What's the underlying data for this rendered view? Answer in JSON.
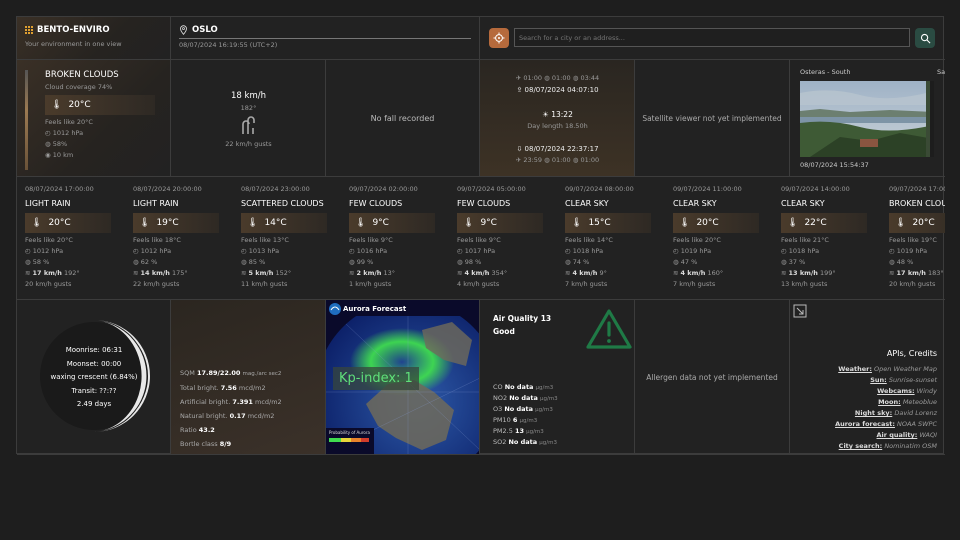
{
  "header": {
    "app_name": "BENTO-ENVIRO",
    "tagline": "Your environment in one view",
    "city": "OSLO",
    "datetime": "08/07/2024 16:19:55 (UTC+2)",
    "search_placeholder": "Search for a city or an address..."
  },
  "current": {
    "condition": "BROKEN CLOUDS",
    "cloud_coverage": "Cloud coverage 74%",
    "temp": "20°C",
    "feels_like": "Feels like 20°C",
    "pressure": "1012 hPa",
    "humidity": "58%",
    "visibility": "10 km"
  },
  "wind": {
    "speed": "18 km/h",
    "direction": "182°",
    "gusts": "22 km/h gusts"
  },
  "fall": {
    "text": "No fall recorded"
  },
  "sun": {
    "dawn_row": [
      "01:00",
      "01:00",
      "03:44"
    ],
    "sunrise": "08/07/2024 04:07:10",
    "solar_noon": "13:22",
    "day_length": "Day length 18.50h",
    "sunset": "08/07/2024 22:37:17",
    "dusk_row": [
      "23:59",
      "01:00",
      "01:00"
    ]
  },
  "satellite": {
    "text": "Satellite viewer not yet implemented"
  },
  "webcam": {
    "title": "Osteras - South",
    "title2": "Sa",
    "timestamp": "08/07/2024 15:54:37"
  },
  "forecast": [
    {
      "date": "08/07/2024 17:00:00",
      "condition": "LIGHT RAIN",
      "temp": "20°C",
      "feels": "Feels like 20°C",
      "pressure": "1012 hPa",
      "humidity": "58 %",
      "wind": "17 km/h",
      "dir": "192°",
      "gusts": "20 km/h gusts"
    },
    {
      "date": "08/07/2024 20:00:00",
      "condition": "LIGHT RAIN",
      "temp": "19°C",
      "feels": "Feels like 18°C",
      "pressure": "1012 hPa",
      "humidity": "62 %",
      "wind": "14 km/h",
      "dir": "175°",
      "gusts": "22 km/h gusts"
    },
    {
      "date": "08/07/2024 23:00:00",
      "condition": "SCATTERED CLOUDS",
      "temp": "14°C",
      "feels": "Feels like 13°C",
      "pressure": "1013 hPa",
      "humidity": "85 %",
      "wind": "5 km/h",
      "dir": "152°",
      "gusts": "11 km/h gusts"
    },
    {
      "date": "09/07/2024 02:00:00",
      "condition": "FEW CLOUDS",
      "temp": "9°C",
      "feels": "Feels like 9°C",
      "pressure": "1016 hPa",
      "humidity": "99 %",
      "wind": "2 km/h",
      "dir": "13°",
      "gusts": "1 km/h gusts"
    },
    {
      "date": "09/07/2024 05:00:00",
      "condition": "FEW CLOUDS",
      "temp": "9°C",
      "feels": "Feels like 9°C",
      "pressure": "1017 hPa",
      "humidity": "98 %",
      "wind": "4 km/h",
      "dir": "354°",
      "gusts": "4 km/h gusts"
    },
    {
      "date": "09/07/2024 08:00:00",
      "condition": "CLEAR SKY",
      "temp": "15°C",
      "feels": "Feels like 14°C",
      "pressure": "1018 hPa",
      "humidity": "74 %",
      "wind": "4 km/h",
      "dir": "9°",
      "gusts": "7 km/h gusts"
    },
    {
      "date": "09/07/2024 11:00:00",
      "condition": "CLEAR SKY",
      "temp": "20°C",
      "feels": "Feels like 20°C",
      "pressure": "1019 hPa",
      "humidity": "47 %",
      "wind": "4 km/h",
      "dir": "160°",
      "gusts": "7 km/h gusts"
    },
    {
      "date": "09/07/2024 14:00:00",
      "condition": "CLEAR SKY",
      "temp": "22°C",
      "feels": "Feels like 21°C",
      "pressure": "1018 hPa",
      "humidity": "37 %",
      "wind": "13 km/h",
      "dir": "199°",
      "gusts": "13 km/h gusts"
    },
    {
      "date": "09/07/2024 17:00:00",
      "condition": "BROKEN CLOUDS",
      "temp": "20°C",
      "feels": "Feels like 19°C",
      "pressure": "1019 hPa",
      "humidity": "48 %",
      "wind": "17 km/h",
      "dir": "183°",
      "gusts": "20 km/h gusts"
    }
  ],
  "moon": {
    "moonrise": "Moonrise: 06:31",
    "moonset": "Moonset: 00:00",
    "phase": "waxing crescent (6.84%)",
    "transit": "Transit: ??:??",
    "age": "2.49 days"
  },
  "night": {
    "sqm_label": "SQM",
    "sqm_value": "17.89/22.00",
    "sqm_unit": "mag./arc sec2",
    "total_label": "Total bright.",
    "total_value": "7.56",
    "total_unit": "mcd/m2",
    "artificial_label": "Artificial bright.",
    "artificial_value": "7.391",
    "artificial_unit": "mcd/m2",
    "natural_label": "Natural bright.",
    "natural_value": "0.17",
    "natural_unit": "mcd/m2",
    "ratio_label": "Ratio",
    "ratio_value": "43.2",
    "bortle_label": "Bortle class",
    "bortle_value": "8/9"
  },
  "aurora": {
    "title": "Aurora Forecast",
    "kp": "Kp-index: 1",
    "legend": "Probability of Aurora"
  },
  "air": {
    "title": "Air Quality 13",
    "status": "Good",
    "rows": [
      {
        "name": "CO",
        "value": "No data",
        "unit": "µg/m3"
      },
      {
        "name": "NO2",
        "value": "No data",
        "unit": "µg/m3"
      },
      {
        "name": "O3",
        "value": "No data",
        "unit": "µg/m3"
      },
      {
        "name": "PM10",
        "value": "6",
        "unit": "µg/m3"
      },
      {
        "name": "PM2.5",
        "value": "13",
        "unit": "µg/m3"
      },
      {
        "name": "SO2",
        "value": "No data",
        "unit": "µg/m3"
      }
    ]
  },
  "allergen": {
    "text": "Allergen data not yet implemented"
  },
  "credits": {
    "title": "APIs, Credits",
    "items": [
      {
        "k": "Weather:",
        "v": "Open Weather Map"
      },
      {
        "k": "Sun:",
        "v": "Sunrise-sunset"
      },
      {
        "k": "Webcams:",
        "v": "Windy"
      },
      {
        "k": "Moon:",
        "v": "Meteoblue"
      },
      {
        "k": "Night sky:",
        "v": "David Lorenz"
      },
      {
        "k": "Aurora forecast:",
        "v": "NOAA SWPC"
      },
      {
        "k": "Air quality:",
        "v": "WAQI"
      },
      {
        "k": "City search:",
        "v": "Nominatim OSM"
      }
    ]
  },
  "colors": {
    "accent": "#b66a3c",
    "warning": "#2e8b57",
    "aurora": "#3fdc4f"
  }
}
